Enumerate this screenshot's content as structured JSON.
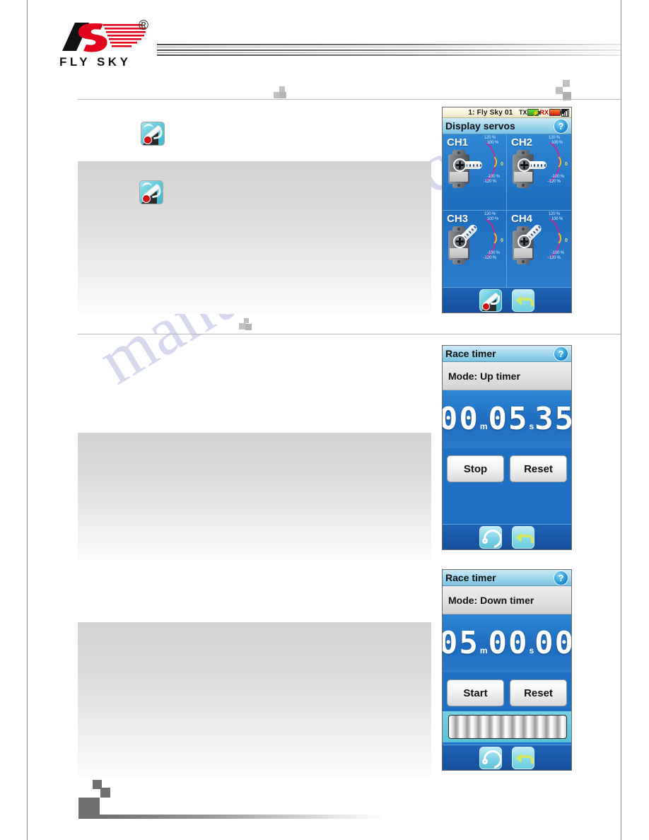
{
  "brand": {
    "name": "FLY SKY",
    "registered": "®"
  },
  "watermark": {
    "text": "manualshive.com"
  },
  "screens": {
    "display_servos": {
      "statusbar": {
        "model": "1: Fly Sky 01",
        "tx_label": "TX",
        "rx_label": "RX"
      },
      "title": "Display servos",
      "help": "?",
      "channels": [
        {
          "label": "CH1",
          "top_hi": "120 %",
          "top_lo": "100 %",
          "zero": "0",
          "bot_lo": "-100 %",
          "bot_hi": "-120 %"
        },
        {
          "label": "CH2",
          "top_hi": "120 %",
          "top_lo": "100 %",
          "zero": "0",
          "bot_lo": "-100 %",
          "bot_hi": "-120 %"
        },
        {
          "label": "CH3",
          "top_hi": "120 %",
          "top_lo": "100 %",
          "zero": "0",
          "bot_lo": "-100 %",
          "bot_hi": "-120 %"
        },
        {
          "label": "CH4",
          "top_hi": "120 %",
          "top_lo": "100 %",
          "zero": "0",
          "bot_lo": "-100 %",
          "bot_hi": "-120 %"
        }
      ]
    },
    "race_timer_up": {
      "title": "Race timer",
      "help": "?",
      "mode": "Mode: Up timer",
      "time": {
        "minutes": "00",
        "m_unit": "m",
        "seconds": "05",
        "s_unit": "s",
        "hundredths": "35"
      },
      "buttons": {
        "primary": "Stop",
        "secondary": "Reset"
      }
    },
    "race_timer_down": {
      "title": "Race timer",
      "help": "?",
      "mode": "Mode: Down timer",
      "time": {
        "minutes": "05",
        "m_unit": "m",
        "seconds": "00",
        "s_unit": "s",
        "hundredths": "00"
      },
      "buttons": {
        "primary": "Start",
        "secondary": "Reset"
      }
    }
  },
  "colors": {
    "brand_red": "#e3051b",
    "lcd_blue": "#1f6fc4",
    "title_blue": "#a4d8ee",
    "status_cream": "#f6f3d8"
  }
}
